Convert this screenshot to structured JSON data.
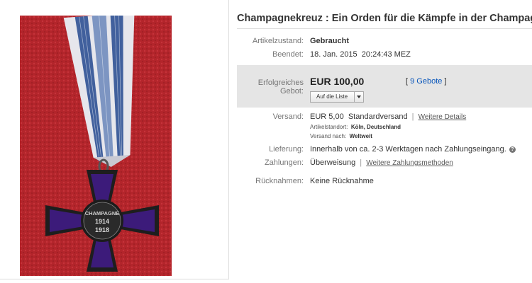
{
  "listing": {
    "title": "Champagnekreuz : Ein Orden für die Kämpfe in der Champagne",
    "image_alt": "Champagne-Kreuz Orden mit Band",
    "cross_text": {
      "top": "CHAMPAGNE",
      "year_start": "1914",
      "year_end": "1918"
    }
  },
  "details": {
    "condition": {
      "label": "Artikelzustand:",
      "value": "Gebraucht"
    },
    "ended": {
      "label": "Beendet:",
      "date": "18. Jan. 2015",
      "time": "20:24:43 MEZ"
    }
  },
  "bid": {
    "label": "Erfolgreiches Gebot:",
    "price": "EUR 100,00",
    "open": "[",
    "count": "9 Gebote",
    "close": "]",
    "watch_label": "Auf die Liste"
  },
  "shipping": {
    "label": "Versand:",
    "cost": "EUR 5,00",
    "method": "Standardversand",
    "pipe": "|",
    "details_link": "Weitere Details",
    "location_label": "Artikelstandort:",
    "location": "Köln, Deutschland",
    "ships_to_label": "Versand nach:",
    "ships_to": "Weltweit"
  },
  "delivery": {
    "label": "Lieferung:",
    "value": "Innerhalb von ca. 2-3 Werktagen nach Zahlungseingang."
  },
  "payments": {
    "label": "Zahlungen:",
    "value": "Überweisung",
    "pipe": "|",
    "more_link": "Weitere Zahlungsmethoden"
  },
  "returns": {
    "label": "Rücknahmen:",
    "value": "Keine Rücknahme"
  },
  "colors": {
    "background_cloth": "#b8272d",
    "ribbon_blue": "#3e5f9c",
    "ribbon_white": "#e8e8ee",
    "cross_enamel": "#3b1a78",
    "link_blue": "#0654ba",
    "bid_box": "#e5e5e5"
  }
}
